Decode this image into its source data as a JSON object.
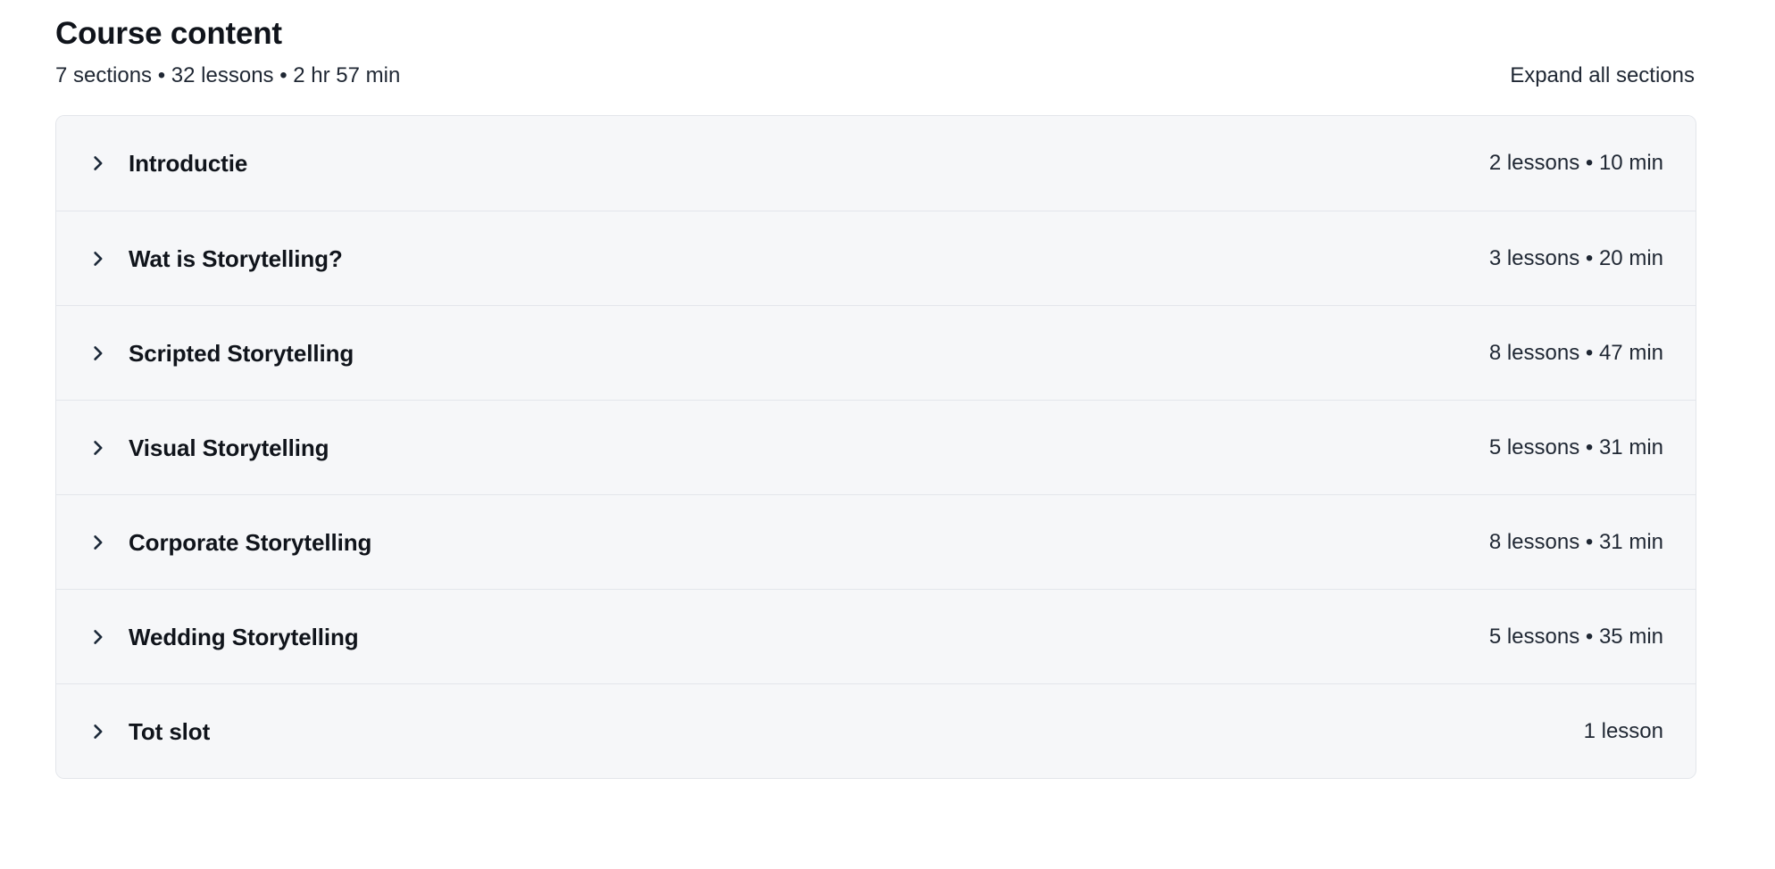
{
  "header": {
    "title": "Course content",
    "summary": "7 sections • 32 lessons • 2 hr 57 min",
    "expand_all_label": "Expand all sections"
  },
  "colors": {
    "page_background": "#ffffff",
    "card_background": "#f6f7f9",
    "card_border": "#e3e6eb",
    "divider": "#e3e6eb",
    "title_text": "#10141b",
    "meta_text": "#1f2733",
    "chevron": "#1b2838"
  },
  "sections": [
    {
      "icon": "chevron-right-icon",
      "title": "Introductie",
      "meta": "2 lessons • 10 min"
    },
    {
      "icon": "chevron-right-icon",
      "title": "Wat is Storytelling?",
      "meta": "3 lessons • 20 min"
    },
    {
      "icon": "chevron-right-icon",
      "title": "Scripted Storytelling",
      "meta": "8 lessons • 47 min"
    },
    {
      "icon": "chevron-right-icon",
      "title": "Visual Storytelling",
      "meta": "5 lessons • 31 min"
    },
    {
      "icon": "chevron-right-icon",
      "title": "Corporate Storytelling",
      "meta": "8 lessons • 31 min"
    },
    {
      "icon": "chevron-right-icon",
      "title": "Wedding Storytelling",
      "meta": "5 lessons • 35 min"
    },
    {
      "icon": "chevron-right-icon",
      "title": "Tot slot",
      "meta": "1 lesson"
    }
  ]
}
